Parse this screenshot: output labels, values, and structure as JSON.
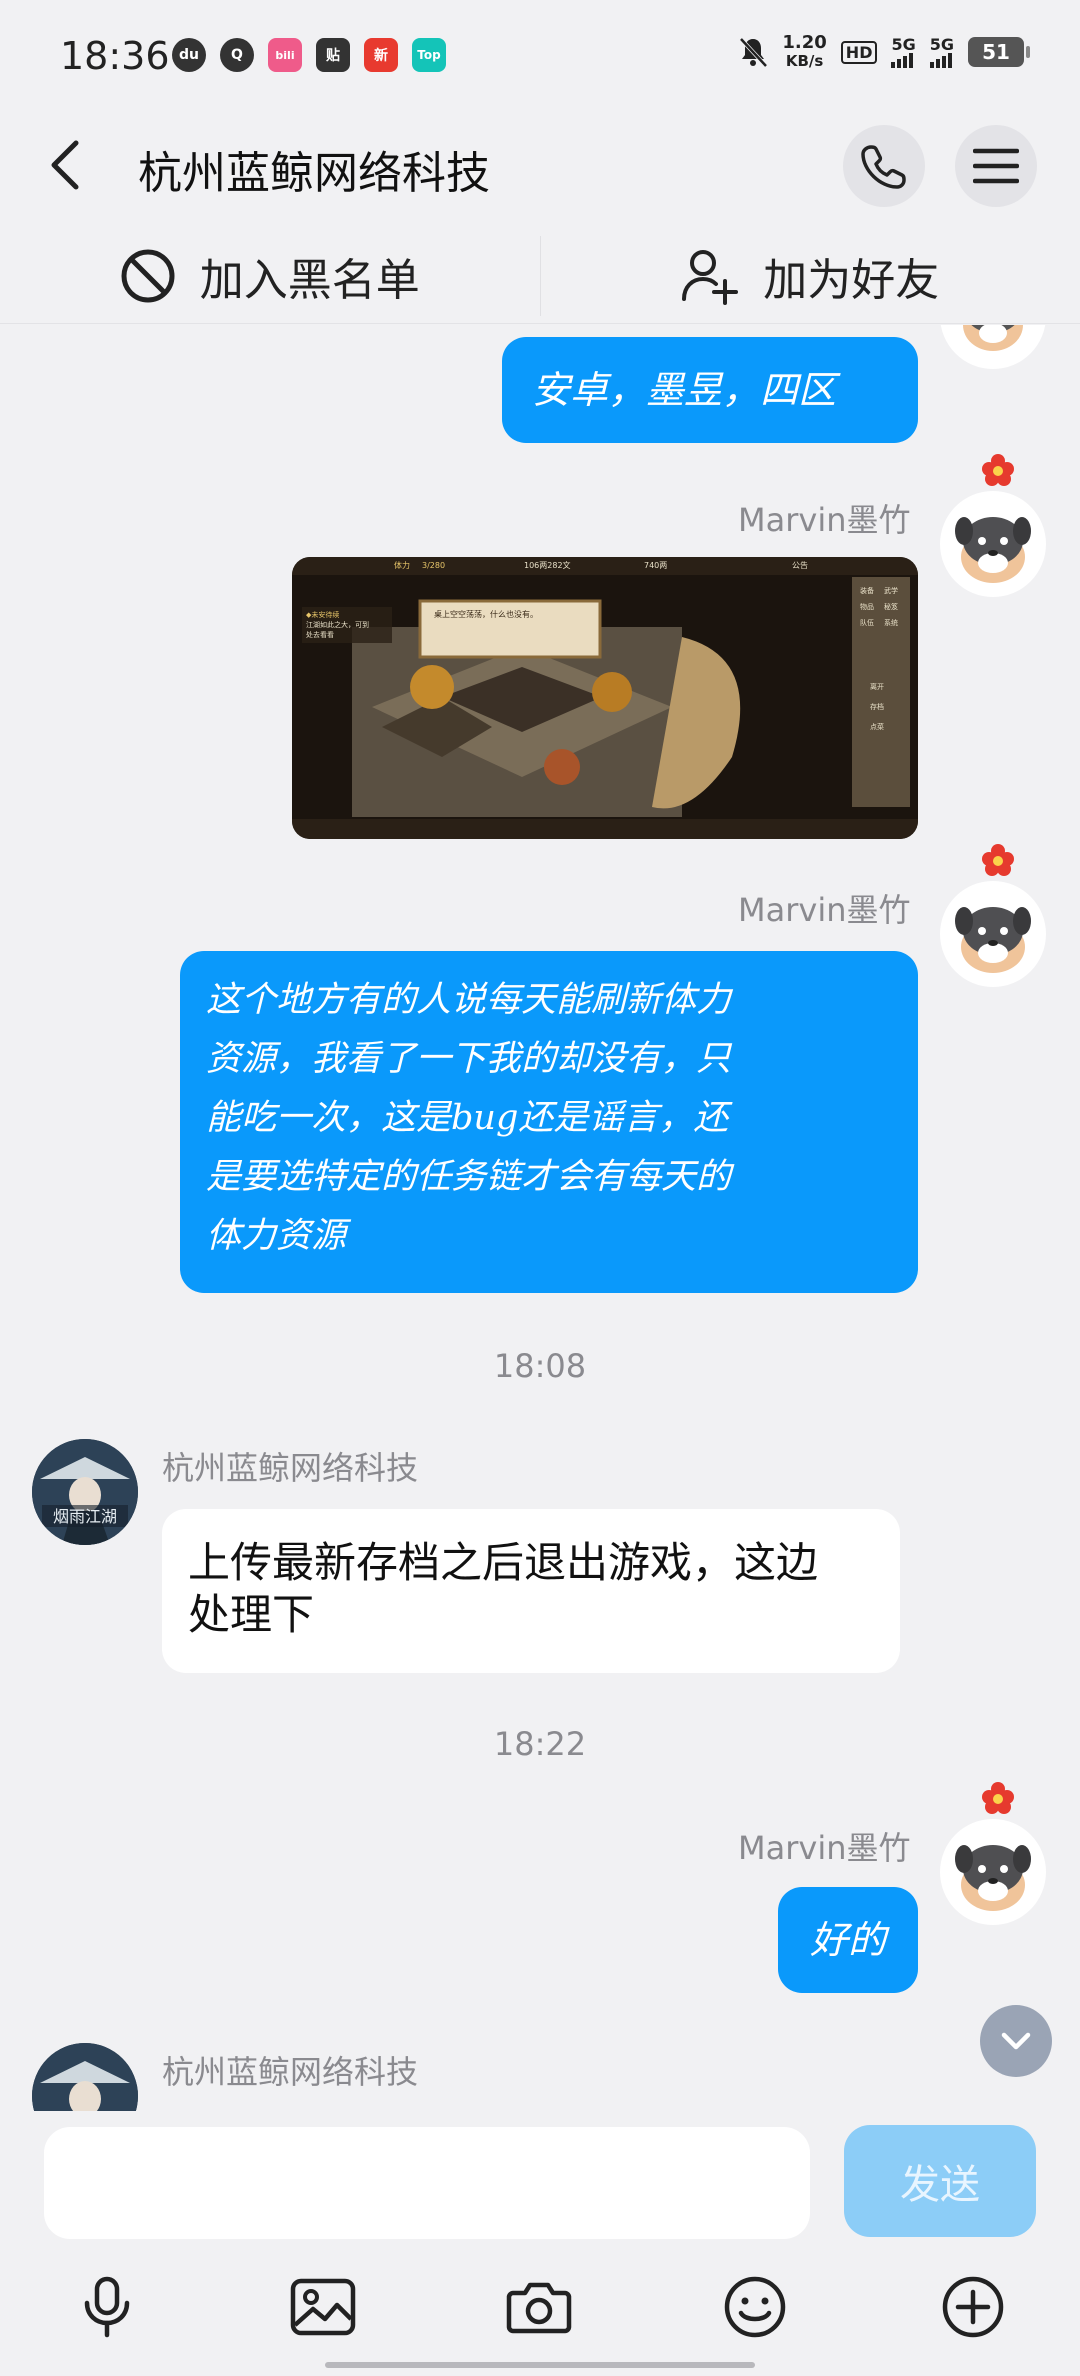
{
  "status_bar": {
    "time": "18:36",
    "apps": [
      {
        "icon": "du-icon",
        "text": "du",
        "color": "#333333"
      },
      {
        "icon": "q-icon",
        "text": "Q",
        "color": "#333333"
      },
      {
        "icon": "bilibili-icon",
        "text": "bili",
        "color": "#ef5b8a"
      },
      {
        "icon": "tieba-icon",
        "text": "贴",
        "color": "#333333"
      },
      {
        "icon": "news-icon",
        "text": "新",
        "color": "#e83a2f"
      },
      {
        "icon": "top-icon",
        "text": "Top",
        "color": "#14c4b8"
      }
    ],
    "net_speed_value": "1.20",
    "net_speed_unit": "KB/s",
    "hd_label": "HD",
    "sim1": "5G",
    "sim2": "5G",
    "battery": "51"
  },
  "header": {
    "title": "杭州蓝鲸网络科技"
  },
  "actions": {
    "blacklist_label": "加入黑名单",
    "add_friend_label": "加为好友"
  },
  "messages": {
    "m1": {
      "text": "安卓，墨昱，四区"
    },
    "m2": {
      "sender": "Marvin墨竹"
    },
    "m3": {
      "sender": "Marvin墨竹",
      "lines": [
        "这个地方有的人说每天能刷新体力",
        "资源，我看了一下我的却没有，只",
        "能吃一次，这是bug还是谣言，还",
        "是要选特定的任务链才会有每天的",
        "体力资源"
      ]
    },
    "time1": "18:08",
    "m4": {
      "sender": "杭州蓝鲸网络科技",
      "avatar_text": "烟雨江湖",
      "lines": [
        "上传最新存档之后退出游戏，这边",
        "处理下"
      ]
    },
    "time2": "18:22",
    "m5": {
      "sender": "Marvin墨竹",
      "text": "好的"
    },
    "m6": {
      "sender": "杭州蓝鲸网络科技"
    }
  },
  "game_ui": {
    "stamina": "3/280",
    "money": "106两282文",
    "gems": "740两",
    "notice": "公告",
    "dialog": "桌上空空荡荡，什么也没有。",
    "quest_title": "◆未安待续",
    "quest_desc_1": "江湖如此之大，可到",
    "quest_desc_2": "处去看看",
    "menu": [
      "装备",
      "武学",
      "物品",
      "秘笈",
      "队伍",
      "系统"
    ],
    "side": [
      "离开",
      "存档",
      "点菜"
    ]
  },
  "input": {
    "placeholder": "",
    "send_label": "发送"
  },
  "colors": {
    "accent_blue": "#0a99fb",
    "send_disabled": "#8ccdf7",
    "background": "#f1f1f3"
  },
  "toolbar_icons": [
    "microphone-icon",
    "image-icon",
    "camera-icon",
    "emoji-icon",
    "plus-icon"
  ]
}
